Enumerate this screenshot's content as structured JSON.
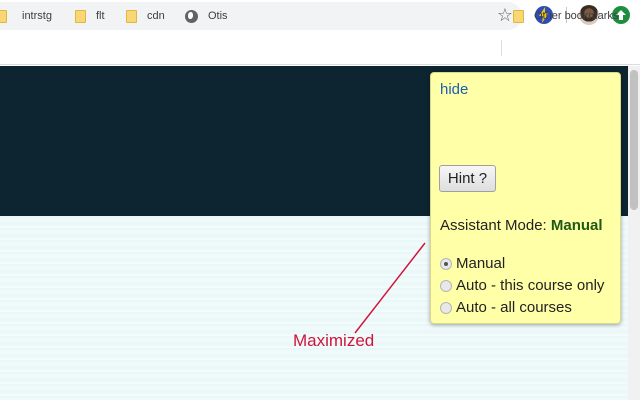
{
  "toolbar": {
    "star_icon": "bookmark-star-icon",
    "extensions": [
      "bolt-extension-icon",
      "profile-avatar",
      "upload-extension-icon"
    ]
  },
  "bookmarks": {
    "items": [
      {
        "label": "",
        "icon": "folder-icon"
      },
      {
        "label": "intrstg",
        "icon": "folder-icon"
      },
      {
        "label": "flt",
        "icon": "folder-icon"
      },
      {
        "label": "cdn",
        "icon": "folder-icon"
      },
      {
        "label": "Otis",
        "icon": "globe-icon"
      }
    ],
    "other": {
      "label": "Other bookmarks",
      "icon": "folder-icon"
    }
  },
  "panel": {
    "hide_label": "hide",
    "hint_label": "Hint ?",
    "mode_label": "Assistant Mode:",
    "mode_value": "Manual",
    "options": [
      {
        "label": "Manual",
        "checked": true
      },
      {
        "label": "Auto - this course only",
        "checked": false
      },
      {
        "label": "Auto - all courses",
        "checked": false
      }
    ]
  },
  "annotation": {
    "text": "Maximized",
    "color": "#d0143c"
  },
  "colors": {
    "panel_bg": "#ffffa8",
    "header_band": "#0d2530",
    "mode_value": "#1e5a14",
    "link": "#1a5fb4"
  }
}
